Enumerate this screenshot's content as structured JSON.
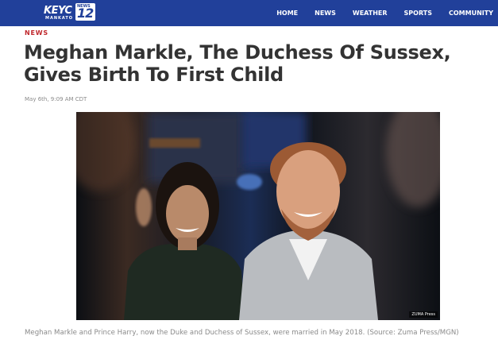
{
  "header": {
    "logo_text": "KEYC",
    "logo_sub": "MANKATO",
    "logo_badge_news": "NEWS",
    "logo_badge_number": "12",
    "nav_items": [
      "HOME",
      "NEWS",
      "WEATHER",
      "SPORTS",
      "COMMUNITY"
    ],
    "brand_color": "#21409a"
  },
  "article": {
    "section": "NEWS",
    "title": "Meghan Markle, The Duchess Of Sussex, Gives Birth To First Child",
    "timestamp": "May 6th, 9:09 AM CDT",
    "photo_credit": "ZUMA Press",
    "caption": "Meghan Markle and Prince Harry, now the Duke and Duchess of Sussex, were married in May 2018. (Source: Zuma Press/MGN)",
    "section_color": "#c0282d"
  }
}
